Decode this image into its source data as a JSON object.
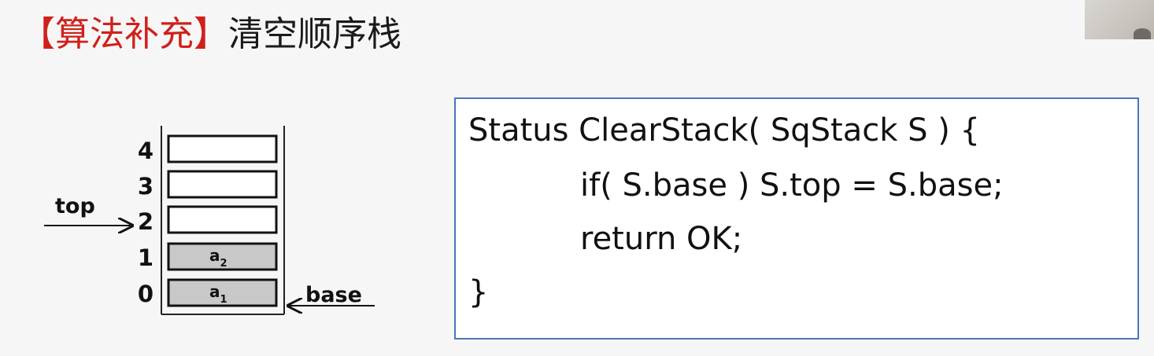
{
  "slide": {
    "title_tag": "【算法补充】",
    "title_main": "清空顺序栈"
  },
  "stack_diagram": {
    "slot_indices": [
      "4",
      "3",
      "2",
      "1",
      "0"
    ],
    "slots": [
      {
        "index": "4",
        "filled": false,
        "element": "",
        "subscript": ""
      },
      {
        "index": "3",
        "filled": false,
        "element": "",
        "subscript": ""
      },
      {
        "index": "2",
        "filled": false,
        "element": "",
        "subscript": ""
      },
      {
        "index": "1",
        "filled": true,
        "element": "a",
        "subscript": "2"
      },
      {
        "index": "0",
        "filled": true,
        "element": "a",
        "subscript": "1"
      }
    ],
    "top_label": "top",
    "base_label": "base",
    "top_points_to_index": "2",
    "base_points_to_index": "0"
  },
  "code": {
    "lines": [
      "Status ClearStack( SqStack S ) {",
      "if( S.base ) S.top = S.base;",
      "return OK;",
      "}"
    ]
  },
  "colors": {
    "title_tag": "#d0201a",
    "title_main": "#1a1a1a",
    "code_border": "#4a76b8",
    "filled_cell": "#c8c8c8"
  }
}
